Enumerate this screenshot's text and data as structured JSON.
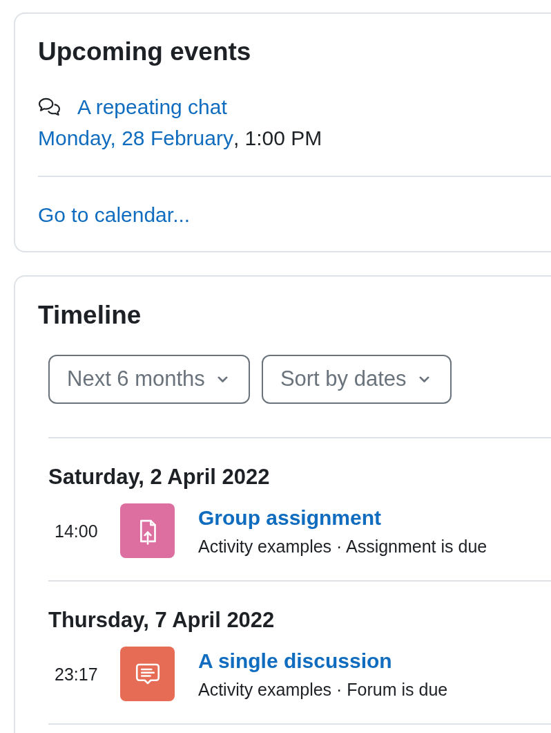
{
  "upcoming_events": {
    "title": "Upcoming events",
    "events": [
      {
        "kind": "chat",
        "name": "A repeating chat",
        "date": "Monday, 28 February",
        "time": ", 1:00 PM"
      }
    ],
    "footer_link": "Go to calendar..."
  },
  "timeline": {
    "title": "Timeline",
    "filters": [
      {
        "label": "Next 6 months"
      },
      {
        "label": "Sort by dates"
      }
    ],
    "groups": [
      {
        "date": "Saturday, 2 April 2022",
        "items": [
          {
            "time": "14:00",
            "kind": "assignment",
            "color": "#dc6ea0",
            "title": "Group assignment",
            "details": "Activity examples · Assignment is due"
          }
        ]
      },
      {
        "date": "Thursday, 7 April 2022",
        "items": [
          {
            "time": "23:17",
            "kind": "forum",
            "color": "#e76c55",
            "title": "A single discussion",
            "details": "Activity examples · Forum is due"
          }
        ]
      }
    ]
  }
}
